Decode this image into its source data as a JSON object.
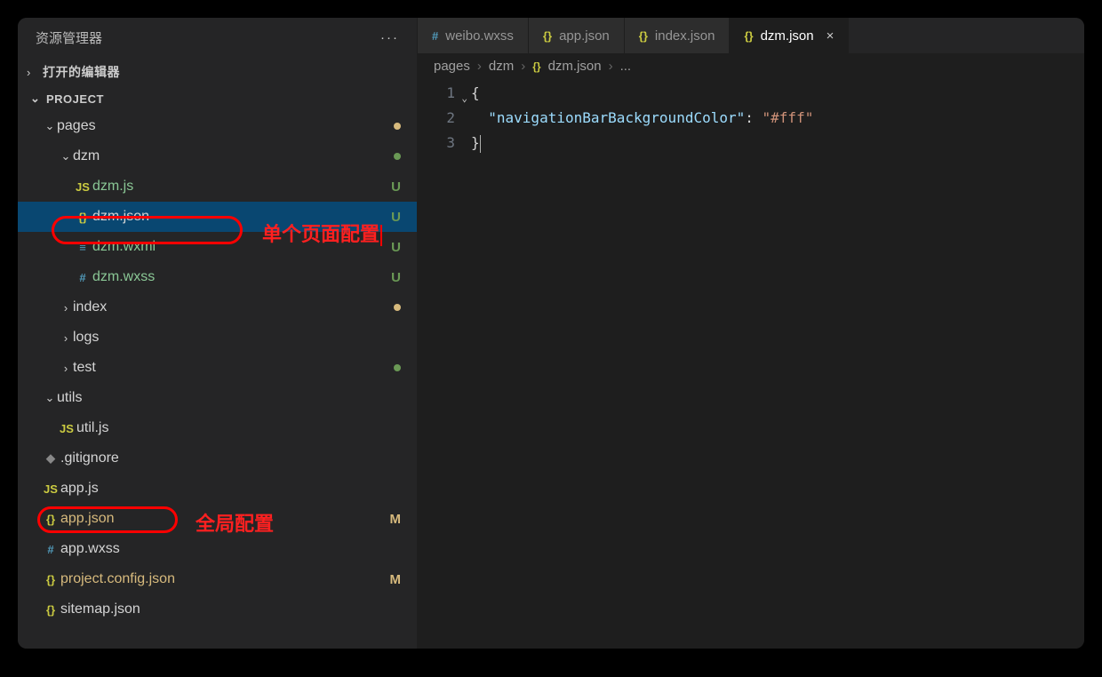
{
  "sidebar": {
    "title": "资源管理器",
    "sections": {
      "openEditors": "打开的编辑器",
      "project": "PROJECT"
    },
    "tree": {
      "pages": {
        "name": "pages",
        "dot": "yellow"
      },
      "dzm": {
        "name": "dzm",
        "dot": "green"
      },
      "dzm_js": {
        "name": "dzm.js",
        "git": "U"
      },
      "dzm_json": {
        "name": "dzm.json",
        "git": "U"
      },
      "dzm_wxml": {
        "name": "dzm.wxml",
        "git": "U"
      },
      "dzm_wxss": {
        "name": "dzm.wxss",
        "git": "U"
      },
      "index": {
        "name": "index",
        "dot": "yellow"
      },
      "logs": {
        "name": "logs"
      },
      "test": {
        "name": "test",
        "dot": "green"
      },
      "utils": {
        "name": "utils"
      },
      "util_js": {
        "name": "util.js"
      },
      "gitignore": {
        "name": ".gitignore"
      },
      "app_js": {
        "name": "app.js"
      },
      "app_json": {
        "name": "app.json",
        "git": "M"
      },
      "app_wxss": {
        "name": "app.wxss"
      },
      "project_config": {
        "name": "project.config.json",
        "git": "M"
      },
      "sitemap": {
        "name": "sitemap.json"
      }
    }
  },
  "annotations": {
    "pageConfig": "单个页面配置",
    "globalConfig": "全局配置"
  },
  "tabs": {
    "t1": "weibo.wxss",
    "t2": "app.json",
    "t3": "index.json",
    "t4": "dzm.json"
  },
  "breadcrumb": {
    "p1": "pages",
    "p2": "dzm",
    "p3": "dzm.json",
    "p4": "..."
  },
  "code": {
    "ln1": "1",
    "ln2": "2",
    "ln3": "3",
    "brace_open": "{",
    "brace_close": "}",
    "key": "\"navigationBarBackgroundColor\"",
    "colon": ":",
    "value": "\"#fff\""
  }
}
